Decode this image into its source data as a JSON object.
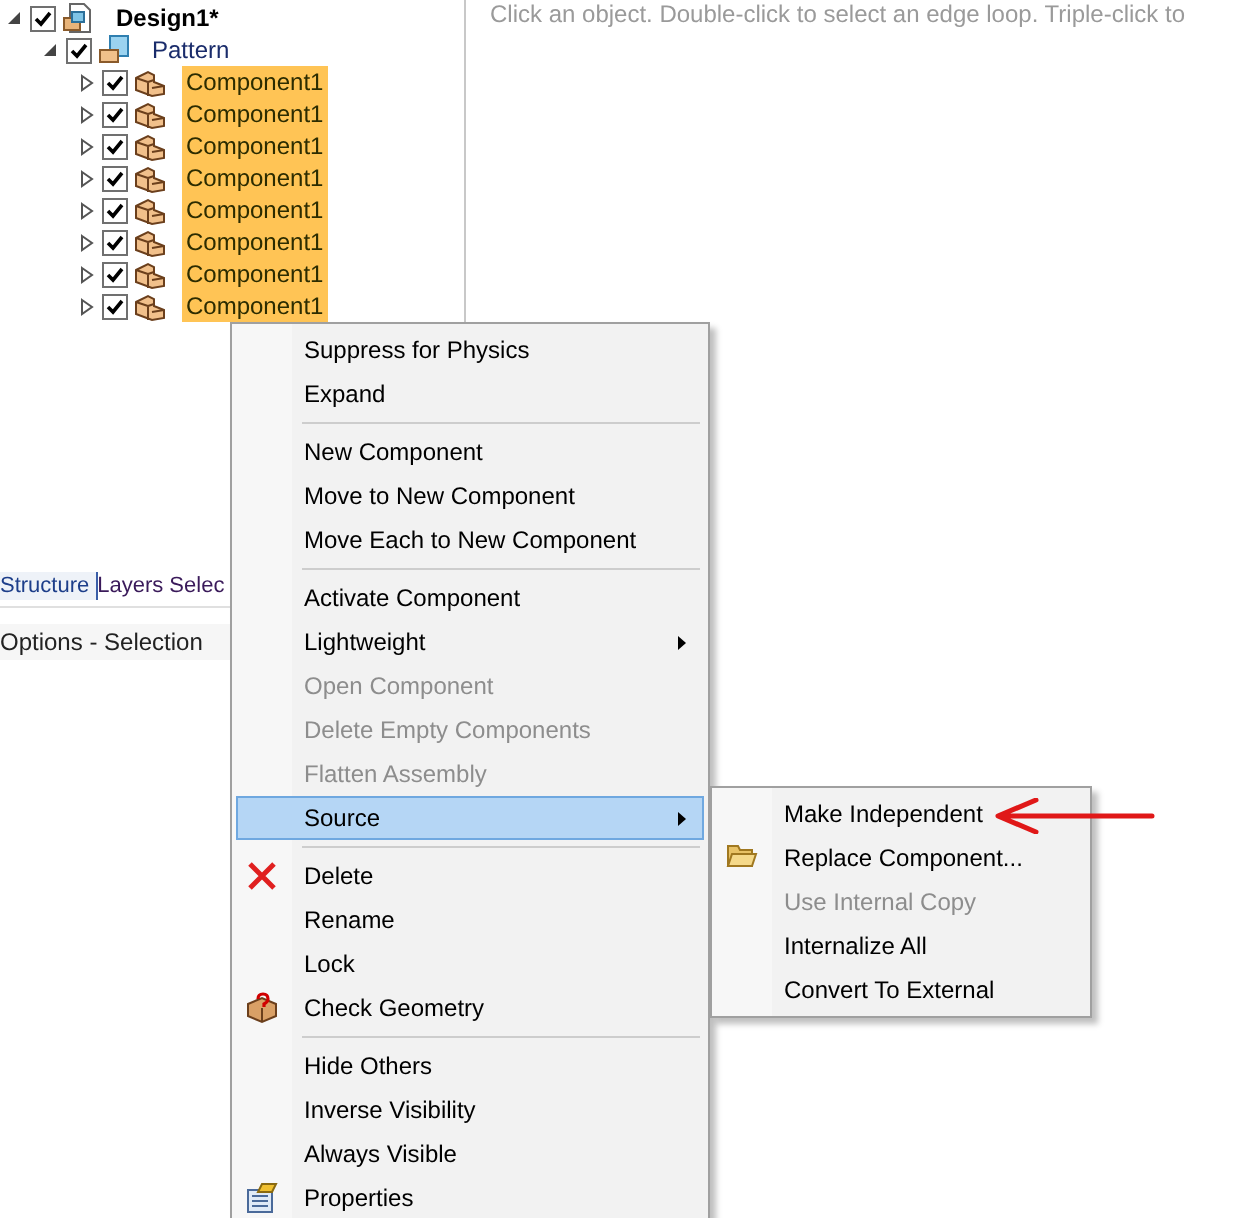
{
  "tree": [
    {
      "label": "Design1*",
      "checked": true,
      "expanded": true,
      "selected": false,
      "kind": "design",
      "children": [
        {
          "label": "Pattern",
          "checked": true,
          "expanded": true,
          "selected": false,
          "kind": "pattern",
          "children": [
            {
              "label": "Component1",
              "checked": true,
              "expanded": false,
              "selected": true,
              "kind": "component"
            },
            {
              "label": "Component1",
              "checked": true,
              "expanded": false,
              "selected": true,
              "kind": "component"
            },
            {
              "label": "Component1",
              "checked": true,
              "expanded": false,
              "selected": true,
              "kind": "component"
            },
            {
              "label": "Component1",
              "checked": true,
              "expanded": false,
              "selected": true,
              "kind": "component"
            },
            {
              "label": "Component1",
              "checked": true,
              "expanded": false,
              "selected": true,
              "kind": "component"
            },
            {
              "label": "Component1",
              "checked": true,
              "expanded": false,
              "selected": true,
              "kind": "component"
            },
            {
              "label": "Component1",
              "checked": true,
              "expanded": false,
              "selected": true,
              "kind": "component"
            },
            {
              "label": "Component1",
              "checked": true,
              "expanded": false,
              "selected": true,
              "kind": "component"
            }
          ]
        }
      ]
    }
  ],
  "panel_tabs": [
    {
      "label": "Structure",
      "selected": true
    },
    {
      "label": "Layers",
      "selected": false
    },
    {
      "label": "Selec",
      "selected": false
    }
  ],
  "options_header": "Options - Selection",
  "hint": "Click an object. Double-click to select an edge loop. Triple-click to",
  "context_menu": [
    {
      "kind": "item",
      "label": "Suppress for Physics",
      "disabled": false,
      "selected": false,
      "submenu": false
    },
    {
      "kind": "item",
      "label": "Expand",
      "disabled": false,
      "selected": false,
      "submenu": false
    },
    {
      "kind": "separator"
    },
    {
      "kind": "item",
      "label": "New Component",
      "disabled": false,
      "selected": false,
      "submenu": false
    },
    {
      "kind": "item",
      "label": "Move to New Component",
      "disabled": false,
      "selected": false,
      "submenu": false
    },
    {
      "kind": "item",
      "label": "Move Each to New Component",
      "disabled": false,
      "selected": false,
      "submenu": false
    },
    {
      "kind": "separator"
    },
    {
      "kind": "item",
      "label": "Activate Component",
      "disabled": false,
      "selected": false,
      "submenu": false
    },
    {
      "kind": "item",
      "label": "Lightweight",
      "disabled": false,
      "selected": false,
      "submenu": true
    },
    {
      "kind": "item",
      "label": "Open Component",
      "disabled": true,
      "selected": false,
      "submenu": false
    },
    {
      "kind": "item",
      "label": "Delete Empty Components",
      "disabled": true,
      "selected": false,
      "submenu": false
    },
    {
      "kind": "item",
      "label": "Flatten Assembly",
      "disabled": true,
      "selected": false,
      "submenu": false
    },
    {
      "kind": "item",
      "label": "Source",
      "disabled": false,
      "selected": true,
      "submenu": true
    },
    {
      "kind": "separator"
    },
    {
      "kind": "item",
      "label": "Delete",
      "disabled": false,
      "selected": false,
      "submenu": false
    },
    {
      "kind": "item",
      "label": "Rename",
      "disabled": false,
      "selected": false,
      "submenu": false
    },
    {
      "kind": "item",
      "label": "Lock",
      "disabled": false,
      "selected": false,
      "submenu": false
    },
    {
      "kind": "item",
      "label": "Check Geometry",
      "disabled": false,
      "selected": false,
      "submenu": false
    },
    {
      "kind": "separator"
    },
    {
      "kind": "item",
      "label": "Hide Others",
      "disabled": false,
      "selected": false,
      "submenu": false
    },
    {
      "kind": "item",
      "label": "Inverse Visibility",
      "disabled": false,
      "selected": false,
      "submenu": false
    },
    {
      "kind": "item",
      "label": "Always Visible",
      "disabled": false,
      "selected": false,
      "submenu": false
    },
    {
      "kind": "item",
      "label": "Properties",
      "disabled": false,
      "selected": false,
      "submenu": false
    }
  ],
  "source_submenu": [
    {
      "kind": "item",
      "label": "Make Independent",
      "disabled": false,
      "selected": false,
      "submenu": false
    },
    {
      "kind": "item",
      "label": "Replace Component...",
      "disabled": false,
      "selected": false,
      "submenu": false
    },
    {
      "kind": "item",
      "label": "Use Internal Copy",
      "disabled": true,
      "selected": false,
      "submenu": false
    },
    {
      "kind": "item",
      "label": "Internalize All",
      "disabled": false,
      "selected": false,
      "submenu": false
    },
    {
      "kind": "item",
      "label": "Convert To External",
      "disabled": false,
      "selected": false,
      "submenu": false
    }
  ]
}
